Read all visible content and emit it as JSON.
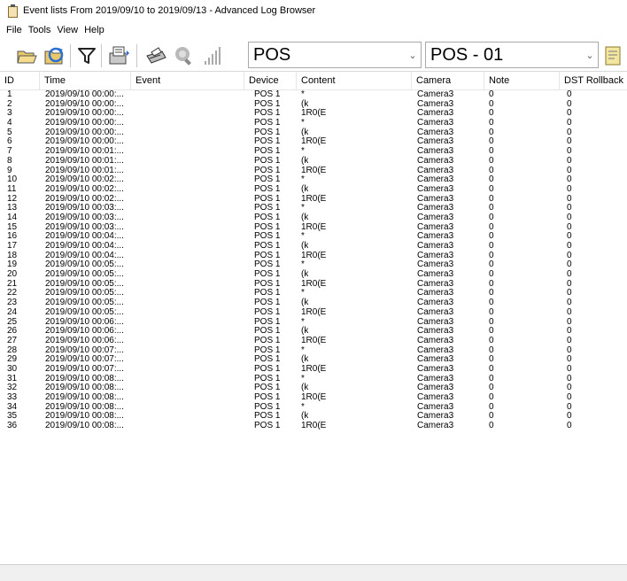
{
  "window": {
    "title": "Event lists From 2019/09/10 to 2019/09/13 - Advanced Log Browser"
  },
  "menu": [
    "File",
    "Tools",
    "View",
    "Help"
  ],
  "toolbar": {
    "buttons": [
      {
        "name": "open-folder-icon"
      },
      {
        "name": "refresh-icon"
      },
      {
        "name": "filter-icon"
      },
      {
        "name": "export-icon"
      },
      {
        "name": "print-icon"
      },
      {
        "name": "zoom-icon"
      },
      {
        "name": "signal-bars-icon"
      }
    ],
    "device_combo": "POS",
    "channel_combo": "POS - 01"
  },
  "table": {
    "columns": [
      "ID",
      "Time",
      "Event",
      "Device",
      "Content",
      "Camera",
      "Note",
      "DST Rollback"
    ],
    "rows": [
      [
        "1",
        "2019/09/10 00:00:...",
        "",
        "POS 1",
        "*",
        "Camera3",
        "0",
        "0"
      ],
      [
        "2",
        "2019/09/10 00:00:...",
        "",
        "POS 1",
        "(k",
        "Camera3",
        "0",
        "0"
      ],
      [
        "3",
        "2019/09/10 00:00:...",
        "",
        "POS 1",
        "1R0(E",
        "Camera3",
        "0",
        "0"
      ],
      [
        "4",
        "2019/09/10 00:00:...",
        "",
        "POS 1",
        "*",
        "Camera3",
        "0",
        "0"
      ],
      [
        "5",
        "2019/09/10 00:00:...",
        "",
        "POS 1",
        "(k",
        "Camera3",
        "0",
        "0"
      ],
      [
        "6",
        "2019/09/10 00:00:...",
        "",
        "POS 1",
        "1R0(E",
        "Camera3",
        "0",
        "0"
      ],
      [
        "7",
        "2019/09/10 00:01:...",
        "",
        "POS 1",
        "*",
        "Camera3",
        "0",
        "0"
      ],
      [
        "8",
        "2019/09/10 00:01:...",
        "",
        "POS 1",
        "(k",
        "Camera3",
        "0",
        "0"
      ],
      [
        "9",
        "2019/09/10 00:01:...",
        "",
        "POS 1",
        "1R0(E",
        "Camera3",
        "0",
        "0"
      ],
      [
        "10",
        "2019/09/10 00:02:...",
        "",
        "POS 1",
        "*",
        "Camera3",
        "0",
        "0"
      ],
      [
        "11",
        "2019/09/10 00:02:...",
        "",
        "POS 1",
        "(k",
        "Camera3",
        "0",
        "0"
      ],
      [
        "12",
        "2019/09/10 00:02:...",
        "",
        "POS 1",
        "1R0(E",
        "Camera3",
        "0",
        "0"
      ],
      [
        "13",
        "2019/09/10 00:03:...",
        "",
        "POS 1",
        "*",
        "Camera3",
        "0",
        "0"
      ],
      [
        "14",
        "2019/09/10 00:03:...",
        "",
        "POS 1",
        "(k",
        "Camera3",
        "0",
        "0"
      ],
      [
        "15",
        "2019/09/10 00:03:...",
        "",
        "POS 1",
        "1R0(E",
        "Camera3",
        "0",
        "0"
      ],
      [
        "16",
        "2019/09/10 00:04:...",
        "",
        "POS 1",
        "*",
        "Camera3",
        "0",
        "0"
      ],
      [
        "17",
        "2019/09/10 00:04:...",
        "",
        "POS 1",
        "(k",
        "Camera3",
        "0",
        "0"
      ],
      [
        "18",
        "2019/09/10 00:04:...",
        "",
        "POS 1",
        "1R0(E",
        "Camera3",
        "0",
        "0"
      ],
      [
        "19",
        "2019/09/10 00:05:...",
        "",
        "POS 1",
        "*",
        "Camera3",
        "0",
        "0"
      ],
      [
        "20",
        "2019/09/10 00:05:...",
        "",
        "POS 1",
        "(k",
        "Camera3",
        "0",
        "0"
      ],
      [
        "21",
        "2019/09/10 00:05:...",
        "",
        "POS 1",
        "1R0(E",
        "Camera3",
        "0",
        "0"
      ],
      [
        "22",
        "2019/09/10 00:05:...",
        "",
        "POS 1",
        "*",
        "Camera3",
        "0",
        "0"
      ],
      [
        "23",
        "2019/09/10 00:05:...",
        "",
        "POS 1",
        "(k",
        "Camera3",
        "0",
        "0"
      ],
      [
        "24",
        "2019/09/10 00:05:...",
        "",
        "POS 1",
        "1R0(E",
        "Camera3",
        "0",
        "0"
      ],
      [
        "25",
        "2019/09/10 00:06:...",
        "",
        "POS 1",
        "*",
        "Camera3",
        "0",
        "0"
      ],
      [
        "26",
        "2019/09/10 00:06:...",
        "",
        "POS 1",
        "(k",
        "Camera3",
        "0",
        "0"
      ],
      [
        "27",
        "2019/09/10 00:06:...",
        "",
        "POS 1",
        "1R0(E",
        "Camera3",
        "0",
        "0"
      ],
      [
        "28",
        "2019/09/10 00:07:...",
        "",
        "POS 1",
        "*",
        "Camera3",
        "0",
        "0"
      ],
      [
        "29",
        "2019/09/10 00:07:...",
        "",
        "POS 1",
        "(k",
        "Camera3",
        "0",
        "0"
      ],
      [
        "30",
        "2019/09/10 00:07:...",
        "",
        "POS 1",
        "1R0(E",
        "Camera3",
        "0",
        "0"
      ],
      [
        "31",
        "2019/09/10 00:08:...",
        "",
        "POS 1",
        "*",
        "Camera3",
        "0",
        "0"
      ],
      [
        "32",
        "2019/09/10 00:08:...",
        "",
        "POS 1",
        "(k",
        "Camera3",
        "0",
        "0"
      ],
      [
        "33",
        "2019/09/10 00:08:...",
        "",
        "POS 1",
        "1R0(E",
        "Camera3",
        "0",
        "0"
      ],
      [
        "34",
        "2019/09/10 00:08:...",
        "",
        "POS 1",
        "*",
        "Camera3",
        "0",
        "0"
      ],
      [
        "35",
        "2019/09/10 00:08:...",
        "",
        "POS 1",
        "(k",
        "Camera3",
        "0",
        "0"
      ],
      [
        "36",
        "2019/09/10 00:08:...",
        "",
        "POS 1",
        "1R0(E",
        "Camera3",
        "0",
        "0"
      ]
    ]
  }
}
